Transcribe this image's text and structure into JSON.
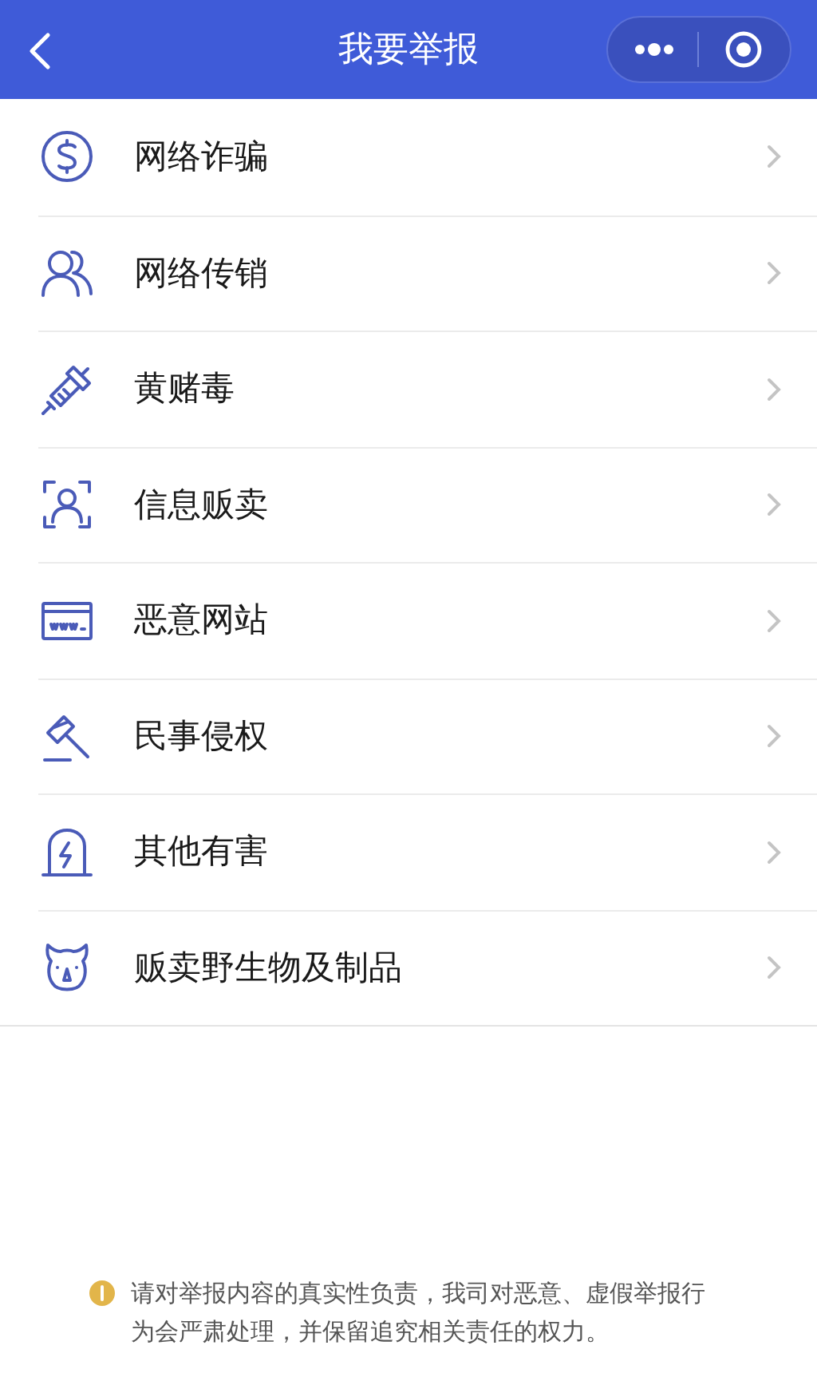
{
  "header": {
    "title": "我要举报"
  },
  "items": [
    {
      "label": "网络诈骗"
    },
    {
      "label": "网络传销"
    },
    {
      "label": "黄赌毒"
    },
    {
      "label": "信息贩卖"
    },
    {
      "label": "恶意网站"
    },
    {
      "label": "民事侵权"
    },
    {
      "label": "其他有害"
    },
    {
      "label": "贩卖野生物及制品"
    }
  ],
  "notice": "请对举报内容的真实性负责，我司对恶意、虚假举报行为会严肃处理，并保留追究相关责任的权力。"
}
